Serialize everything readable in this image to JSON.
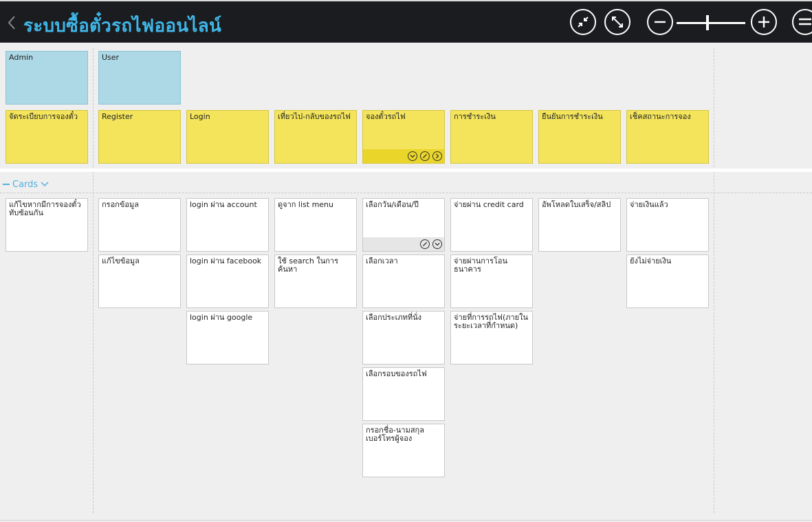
{
  "header": {
    "title": "ระบบซื้อตั๋วรถไฟออนไลน์"
  },
  "icons": {
    "back": "chevron-left-icon",
    "collapse": "collapse-icon",
    "expand": "expand-icon",
    "zoom_out": "zoom-out-icon",
    "zoom_in": "zoom-in-icon",
    "menu": "menu-icon"
  },
  "zoom": {
    "level": 0.45
  },
  "roles": [
    {
      "label": "Admin"
    },
    {
      "label": "User"
    }
  ],
  "activities": [
    {
      "label": "จัดระเบียบการจองตั๋ว"
    },
    {
      "label": "Register"
    },
    {
      "label": "Login"
    },
    {
      "label": "เที่ยวไป-กลับของรถไฟ"
    },
    {
      "label": "จองตั๋วรถไฟ"
    },
    {
      "label": "การชำระเงิน"
    },
    {
      "label": "ยืนยันการชำระเงิน"
    },
    {
      "label": "เช็คสถานะการจอง"
    }
  ],
  "swimlane": {
    "label": "Cards"
  },
  "columns": [
    {
      "cards": [
        "แก้ไขหากมีการจองตั๋วทับซ้อนกัน"
      ]
    },
    {
      "cards": [
        "กรอกข้อมูล",
        "แก้ไขข้อมูล"
      ]
    },
    {
      "cards": [
        "login ผ่าน account",
        "login ผ่าน facebook",
        "login ผ่าน google"
      ]
    },
    {
      "cards": [
        "ดูจาก list menu",
        "ใช้ search ในการค้นหา"
      ]
    },
    {
      "cards": [
        "เลือกวัน/เดือน/ปี",
        "เลือกเวลา",
        "เลือกประเภทที่นั่ง",
        "เลือกรอบของรถไฟ",
        "กรอกชื่อ-นามสกุล เบอร์โทรผู้จอง"
      ]
    },
    {
      "cards": [
        "จ่ายผ่าน credit card",
        "จ่ายผ่านการโอนธนาคาร",
        "จ่ายที่การรถไฟ(ภายในระยะเวลาที่กำหนด)"
      ]
    },
    {
      "cards": [
        "อัพโหลดใบเสร็จ/สลิป"
      ]
    },
    {
      "cards": [
        "จ่ายเงินแล้ว",
        "ยังไม่จ่ายเงิน"
      ]
    }
  ]
}
